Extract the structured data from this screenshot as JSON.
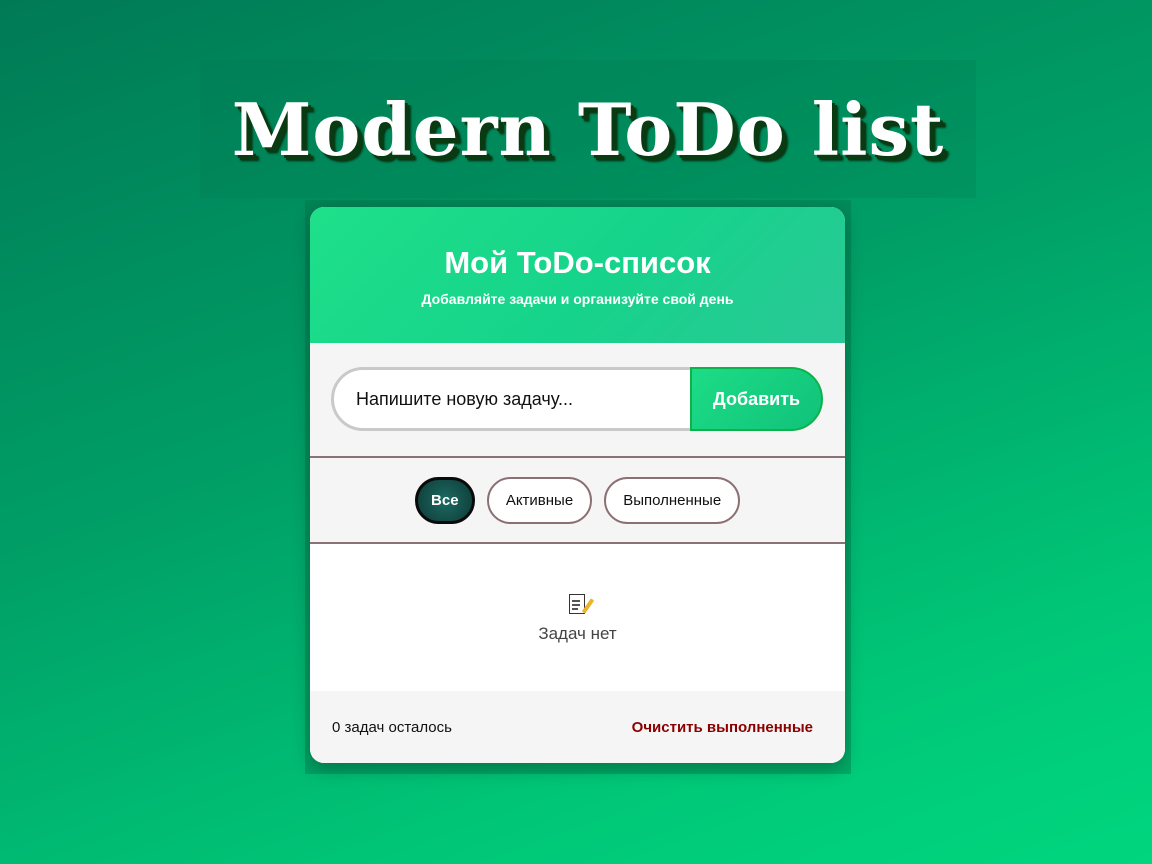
{
  "headline": "Modern ToDo list",
  "card": {
    "title": "Мой ToDo-список",
    "subtitle": "Добавляйте задачи и организуйте свой день"
  },
  "input": {
    "placeholder": "Напишите новую задачу...",
    "value": "",
    "add_label": "Добавить"
  },
  "filters": [
    {
      "label": "Все",
      "active": true
    },
    {
      "label": "Активные",
      "active": false
    },
    {
      "label": "Выполненные",
      "active": false
    }
  ],
  "empty_state": {
    "icon": "memo-icon",
    "text": "Задач нет"
  },
  "footer": {
    "remaining": "0 задач осталось",
    "clear_label": "Очистить выполненные"
  },
  "colors": {
    "background_start": "#007a55",
    "background_end": "#00d67e",
    "header_accent": "#1ee08a",
    "active_filter": "#0e3a36",
    "clear_text": "#8b0000"
  }
}
